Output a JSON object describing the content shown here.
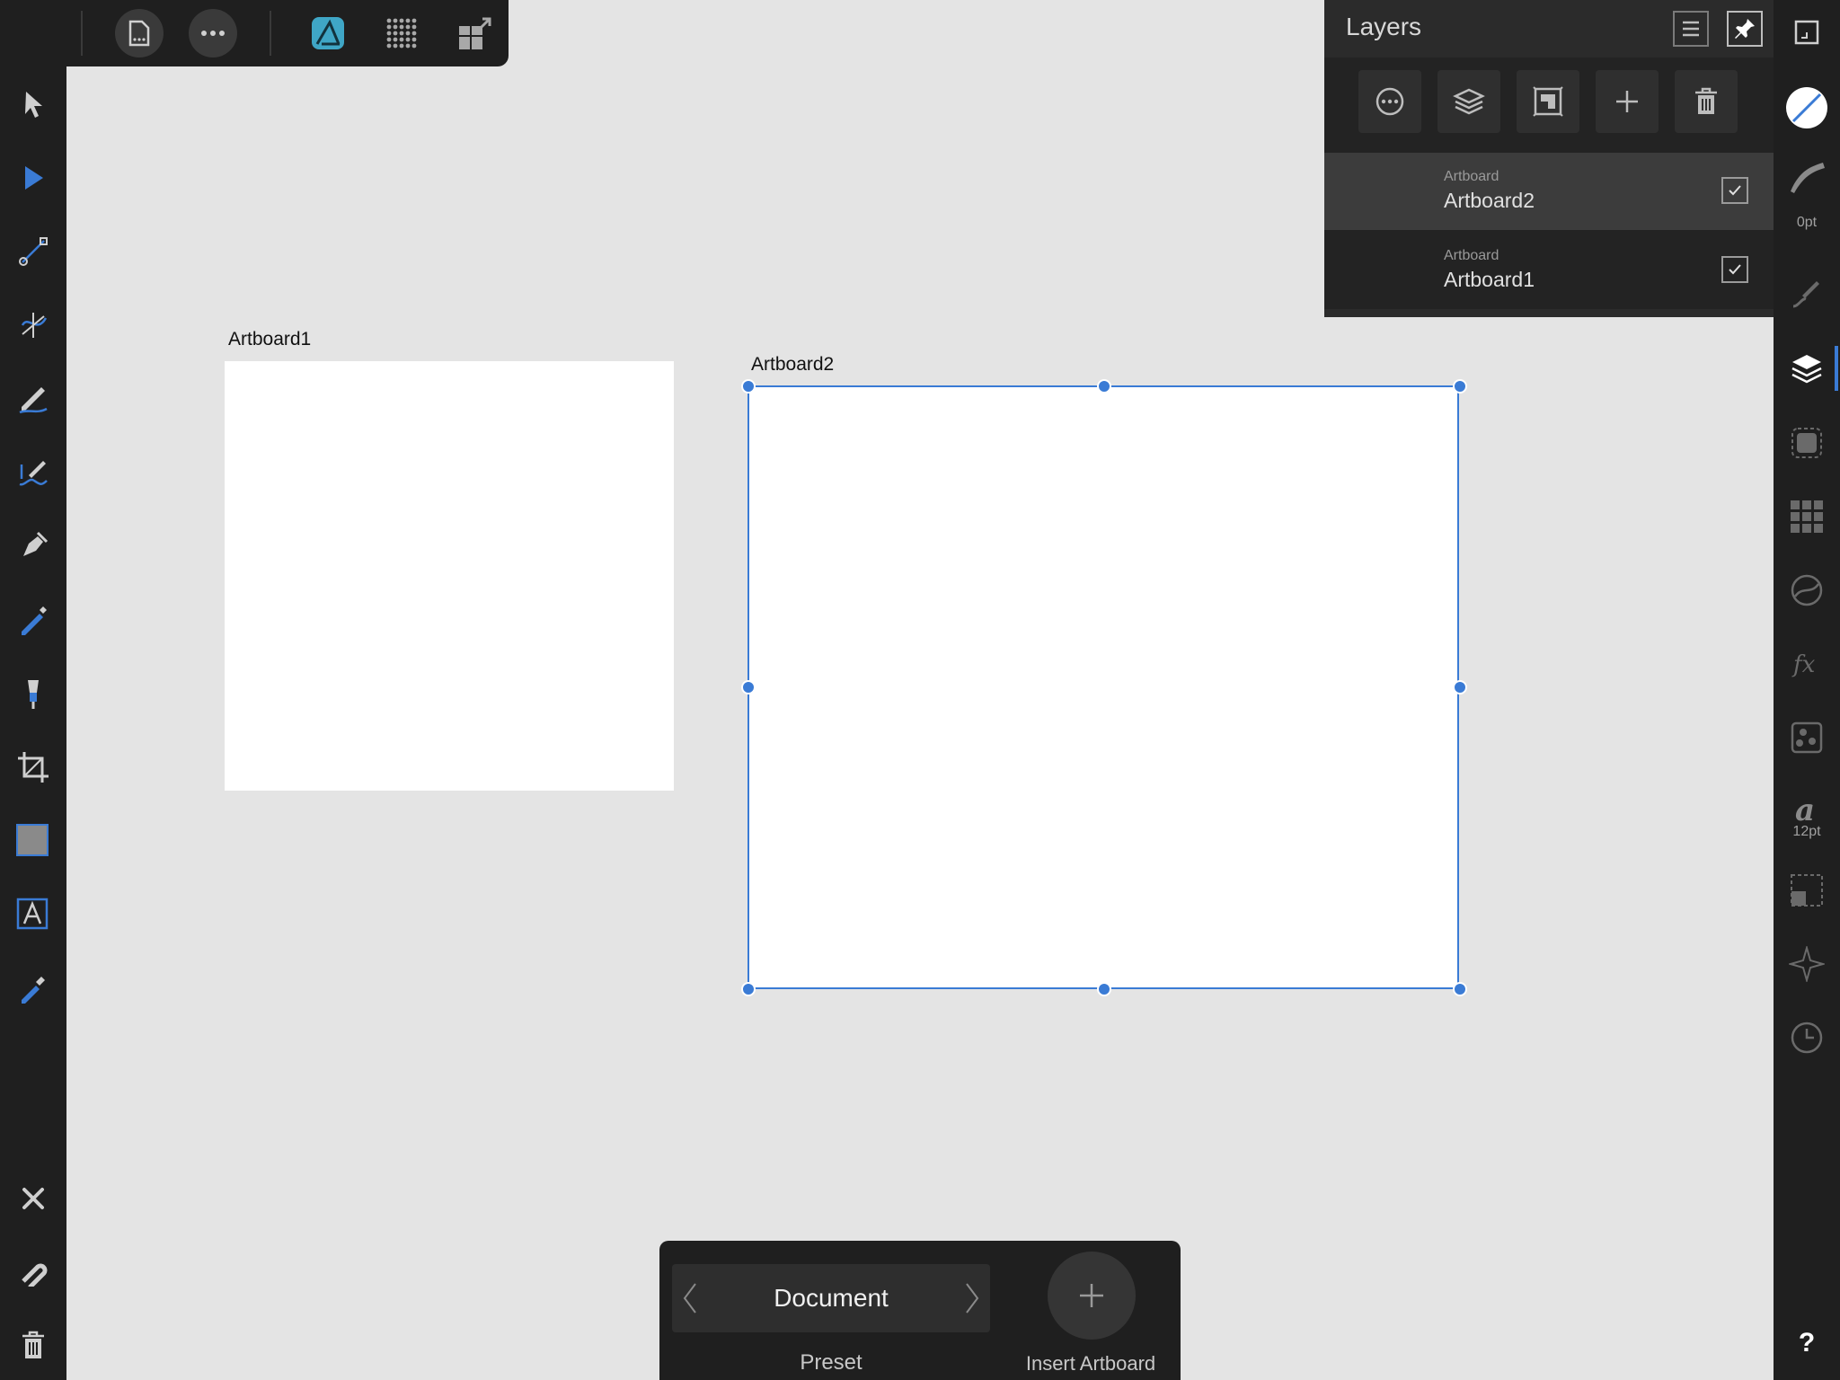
{
  "app": {
    "accent_color": "#3a7bd5",
    "canvas_color": "#e4e4e4",
    "ui_dark_color": "#1f1f1f"
  },
  "top_toolbar": {
    "icons": [
      "back-icon",
      "document-icon",
      "more-icon",
      "designer-persona-icon",
      "pixel-persona-icon",
      "export-persona-icon"
    ]
  },
  "left_tools": {
    "icons": [
      "move-tool-icon",
      "node-tool-icon",
      "corner-tool-icon",
      "point-transform-tool-icon",
      "pencil-tool-icon",
      "vector-brush-tool-icon",
      "pen-tool-icon",
      "fill-tool-icon",
      "transparency-tool-icon",
      "crop-tool-icon",
      "shape-tool-icon",
      "text-tool-icon",
      "color-picker-tool-icon",
      "close-icon",
      "snapping-icon",
      "delete-icon"
    ]
  },
  "layers_panel": {
    "title": "Layers",
    "actions": [
      "layer-options-icon",
      "layer-stack-icon",
      "mask-icon",
      "add-layer-icon",
      "delete-layer-icon"
    ],
    "layers": [
      {
        "type": "Artboard",
        "name": "Artboard2",
        "visible": true,
        "selected": true
      },
      {
        "type": "Artboard",
        "name": "Artboard1",
        "visible": true,
        "selected": false
      }
    ]
  },
  "right_bar": {
    "stroke_width": "0pt",
    "font_size": "12pt",
    "help": "?"
  },
  "canvas": {
    "artboards": [
      {
        "label": "Artboard1"
      },
      {
        "label": "Artboard2",
        "selected": true
      }
    ]
  },
  "context_toolbar": {
    "preset_value": "Document",
    "preset_label": "Preset",
    "insert_label": "Insert Artboard"
  }
}
